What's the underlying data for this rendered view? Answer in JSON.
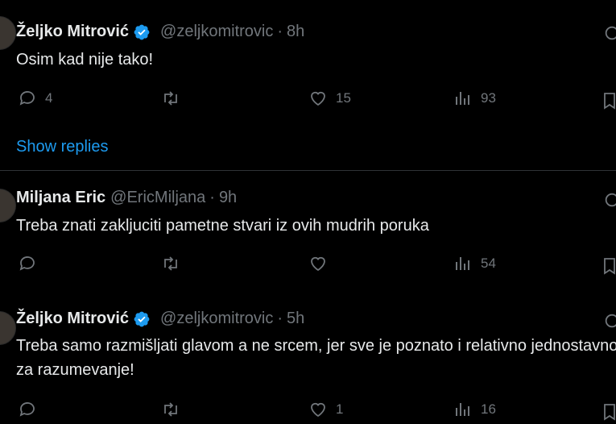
{
  "tweets": [
    {
      "name": "Željko Mitrović",
      "verified": true,
      "handle": "@zeljkomitrovic",
      "separator": "·",
      "time": "8h",
      "text": "Osim kad nije tako!",
      "replies": "4",
      "reposts": "",
      "likes": "15",
      "views": "93"
    },
    {
      "name": "Miljana Eric",
      "verified": false,
      "handle": "@EricMiljana",
      "separator": "·",
      "time": "9h",
      "text": "Treba znati zakljuciti pametne stvari iz ovih mudrih poruka",
      "replies": "",
      "reposts": "",
      "likes": "",
      "views": "54"
    },
    {
      "name": "Željko Mitrović",
      "verified": true,
      "handle": "@zeljkomitrovic",
      "separator": "·",
      "time": "5h",
      "text": "Treba samo razmišljati glavom a ne srcem, jer sve je poznato i relativno jednostavno za razumevanje!",
      "replies": "",
      "reposts": "",
      "likes": "1",
      "views": "16"
    }
  ],
  "show_replies": "Show replies",
  "colors": {
    "background": "#000000",
    "text": "#e7e9ea",
    "muted": "#71767b",
    "accent": "#1d9bf0",
    "divider": "#2f3336"
  },
  "icons": [
    "reply-icon",
    "repost-icon",
    "like-icon",
    "views-icon",
    "bookmark-icon",
    "grok-icon",
    "verified-badge-icon"
  ]
}
